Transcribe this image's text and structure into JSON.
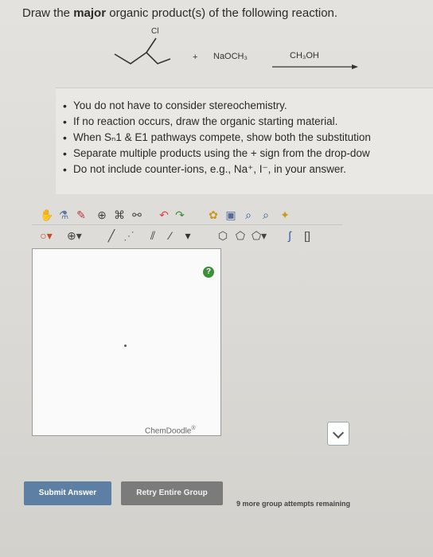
{
  "question": {
    "prefix": "Draw the ",
    "bold": "major",
    "suffix": " organic product(s) of the following reaction."
  },
  "reaction": {
    "substituent": "Cl",
    "plus": "+",
    "reagent": "NaOCH₃",
    "solvent": "CH₃OH"
  },
  "notes": [
    "You do not have to consider stereochemistry.",
    "If no reaction occurs, draw the organic starting material.",
    "When Sₙ1 & E1 pathways compete, show both the substitution",
    "Separate multiple products using the + sign from the drop-dow",
    "Do not include counter-ions, e.g., Na⁺, I⁻, in your answer."
  ],
  "toolbar": {
    "row1": [
      "hand-icon",
      "flask-icon",
      "pencil-icon",
      "ring-icon",
      "template-icon",
      "bond-icon",
      "undo-icon",
      "redo-icon",
      "text-icon",
      "open-icon",
      "zoom-in-icon",
      "zoom-out-icon",
      "clear-icon"
    ],
    "row2": [
      "charge-dropdown-icon",
      "add-atom-icon",
      "single-bond-icon",
      "dashed-bond-icon",
      "double-bond-icon",
      "bold-bond-icon",
      "hexagon-icon",
      "pentagon-icon",
      "ring-dropdown-icon",
      "formula-icon",
      "bracket-icon"
    ]
  },
  "canvas": {
    "help_label": "?",
    "brand": "ChemDoodle",
    "brand_mark": "®"
  },
  "actions": {
    "submit": "Submit Answer",
    "retry": "Retry Entire Group",
    "attempts": "9 more group attempts remaining"
  },
  "colors": {
    "submit_bg": "#5d7fa3",
    "retry_bg": "#7b7b7b",
    "help_green": "#3f8f3a"
  }
}
